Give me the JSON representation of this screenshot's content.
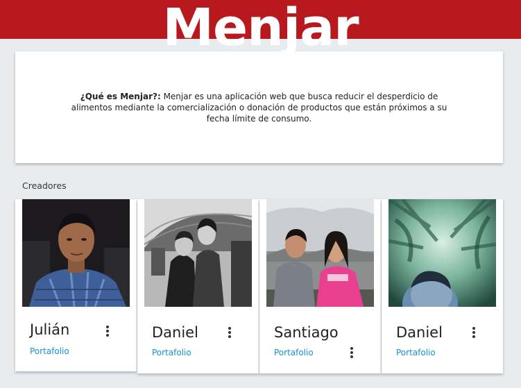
{
  "brand": {
    "name": "Menjar",
    "color": "#b8191e"
  },
  "about": {
    "heading": "¿Qué es Menjar?:",
    "text": " Menjar es una aplicación web que busca reducir el desperdicio de alimentos mediante la comercialización o donación de productos que están próximos a su fecha límite de consumo."
  },
  "creators": {
    "label": "Creadores",
    "items": [
      {
        "name": "Julián",
        "link_label": "Portafolio",
        "menu_icon": "more-vert-icon"
      },
      {
        "name": "Daniel",
        "link_label": "Portafolio",
        "menu_icon": "more-vert-icon"
      },
      {
        "name": "Santiago",
        "link_label": "Portafolio",
        "menu_icon": "more-vert-icon"
      },
      {
        "name": "Daniel",
        "link_label": "Portafolio",
        "menu_icon": "more-vert-icon"
      }
    ]
  }
}
